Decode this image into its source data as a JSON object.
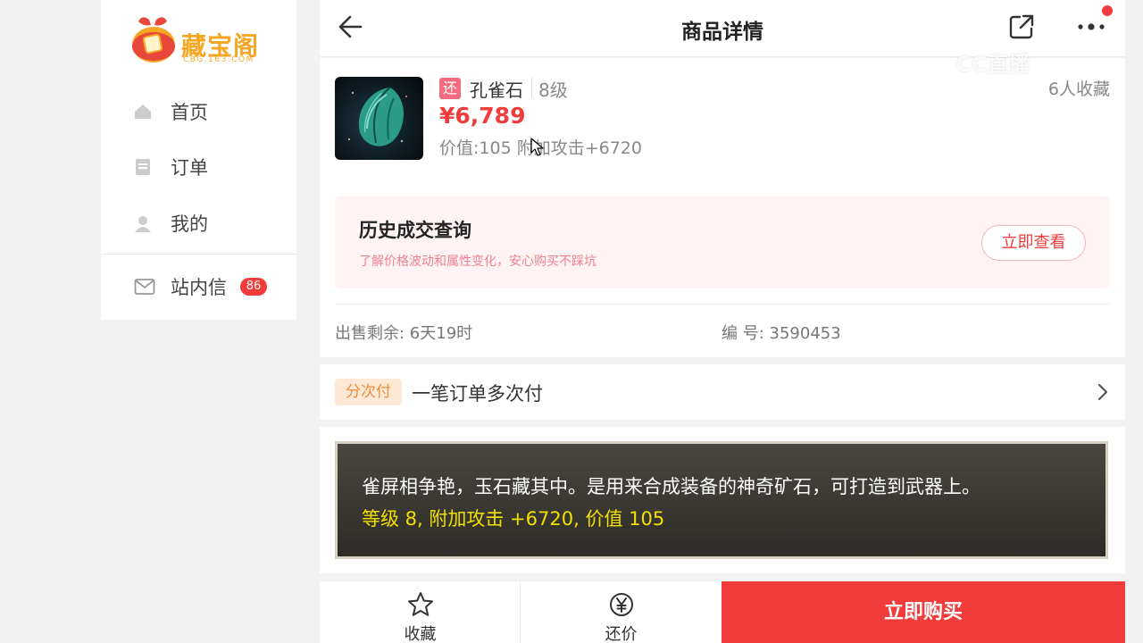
{
  "sidebar": {
    "logo_text": "藏宝阁",
    "logo_sub": "CBG.163.COM",
    "items": [
      {
        "label": "首页",
        "icon": "home-icon"
      },
      {
        "label": "订单",
        "icon": "order-icon"
      },
      {
        "label": "我的",
        "icon": "user-icon"
      },
      {
        "label": "站内信",
        "icon": "mail-icon",
        "badge": "86"
      }
    ]
  },
  "header": {
    "title": "商品详情"
  },
  "product": {
    "tag": "还",
    "name": "孔雀石",
    "level": "8级",
    "fav_count": "6人收藏",
    "price": "¥6,789",
    "attrs": "价值:105 附加攻击+6720"
  },
  "history": {
    "title": "历史成交查询",
    "subtitle": "了解价格波动和属性变化，安心购买不踩坑",
    "button": "立即查看"
  },
  "meta": {
    "remain": "出售剩余: 6天19时",
    "serial": "编 号: 3590453"
  },
  "installment": {
    "tag": "分次付",
    "text": "一笔订单多次付"
  },
  "description": {
    "line1": "雀屏相争艳，玉石藏其中。是用来合成装备的神奇矿石，可打造到武器上。",
    "line2": "等级 8, 附加攻击 +6720, 价值 105"
  },
  "bottom_bar": {
    "favorite": "收藏",
    "bargain": "还价",
    "buy": "立即购买"
  },
  "watermark": "CC直播",
  "colors": {
    "accent_red": "#f23b3b",
    "brand_gold": "#f5a623",
    "desc_highlight": "#f2e000"
  }
}
